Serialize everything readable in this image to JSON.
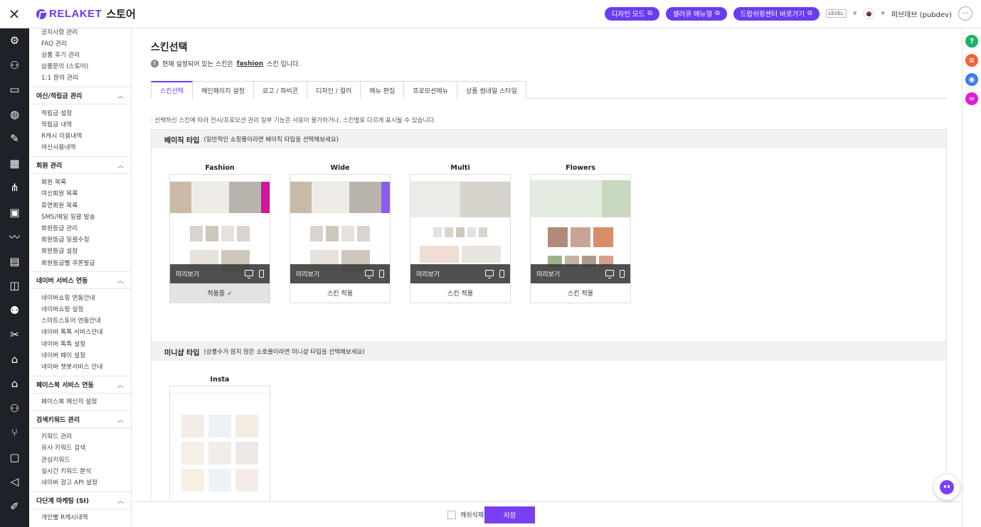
{
  "topbar": {
    "logo_text": "RELAKET",
    "logo_sub": "스토어",
    "buttons": [
      {
        "label": "디자인 모드"
      },
      {
        "label": "셀러큐 매뉴얼"
      },
      {
        "label": "드랍쉬핑센터 바로가기"
      }
    ],
    "level": "LEVEL",
    "user": "퍼브데브 (pubdev)"
  },
  "sidebar": {
    "top_items": [
      "공지사항 관리",
      "FAQ 관리",
      "상품 후기 관리",
      "상품문의 (스토어)",
      "1:1 문의 관리"
    ],
    "groups": [
      {
        "title": "여신/적립금 관리",
        "items": [
          "적립금 설정",
          "적립금 내역",
          "R캐시 이용내역",
          "여신사용내역"
        ]
      },
      {
        "title": "회원 관리",
        "items": [
          "회원 목록",
          "여신회원 목록",
          "휴면회원 목록",
          "SMS/메일 일괄 발송",
          "회원등급 관리",
          "회원등급 일괄수정",
          "회원등급 설정",
          "회원등급별 쿠폰발급"
        ]
      },
      {
        "title": "네이버 서비스 연동",
        "items": [
          "네이버쇼핑 연동안내",
          "네이버쇼핑 설정",
          "스마트스토어 연동안내",
          "네이버 톡톡 서비스안내",
          "네이버 톡톡 설정",
          "네이버 페이 설정",
          "네이버 챗봇서비스 안내"
        ]
      },
      {
        "title": "페이스북 서비스 연동",
        "items": [
          "페이스북 메신저 설정"
        ]
      },
      {
        "title": "검색키워드 관리",
        "items": [
          "키워드 관리",
          "유사 키워드 검색",
          "관심키워드",
          "실시간 키워드 분석",
          "네이버 광고 API 설정"
        ]
      },
      {
        "title": "다단계 마케팅 (SI)",
        "items": [
          "개인별 R캐시내역"
        ]
      }
    ]
  },
  "main": {
    "title": "스킨선택",
    "notice_prefix": "현재 설정되어 있는 스킨은",
    "notice_skin": "fashion",
    "notice_suffix": "스킨 입니다.",
    "tabs": [
      "스킨선택",
      "메인페이지 설정",
      "로고 / 파비콘",
      "디자인 / 컬러",
      "메뉴 편집",
      "프로모션메뉴",
      "상품 썸네일 스타일"
    ],
    "description": "· 선택하신 스킨에 따라 전시/프로모션 관리 일부 기능은 사용이 불가하거나, 스킨별로 다르게 표시될 수 있습니다.",
    "basic_section": {
      "title": "베이직 타입",
      "subtitle": "(일반적인 쇼핑몰이라면 베이직 타입을 선택해보세요)",
      "preview_label": "미리보기",
      "skins": [
        {
          "name": "Fashion",
          "action": "적용중 ✓",
          "active": true
        },
        {
          "name": "Wide",
          "action": "스킨 적용",
          "active": false
        },
        {
          "name": "Multi",
          "action": "스킨 적용",
          "active": false
        },
        {
          "name": "Flowers",
          "action": "스킨 적용",
          "active": false
        }
      ]
    },
    "mini_section": {
      "title": "미니샵 타입",
      "subtitle": "(상품수가 많지 않은 소호몰이라면 미니샵 타입을 선택해보세요)",
      "skins": [
        {
          "name": "Insta"
        }
      ]
    }
  },
  "bottombar": {
    "cache_label": "캐쉬삭제",
    "save_label": "저장"
  },
  "colors": {
    "accent": "#6b3cf2",
    "rail_bg": "#1f2129",
    "help_green": "#1fb16a",
    "help_orange": "#f2613a",
    "help_blue": "#3d7bf0",
    "help_magenta": "#e11bd6"
  }
}
